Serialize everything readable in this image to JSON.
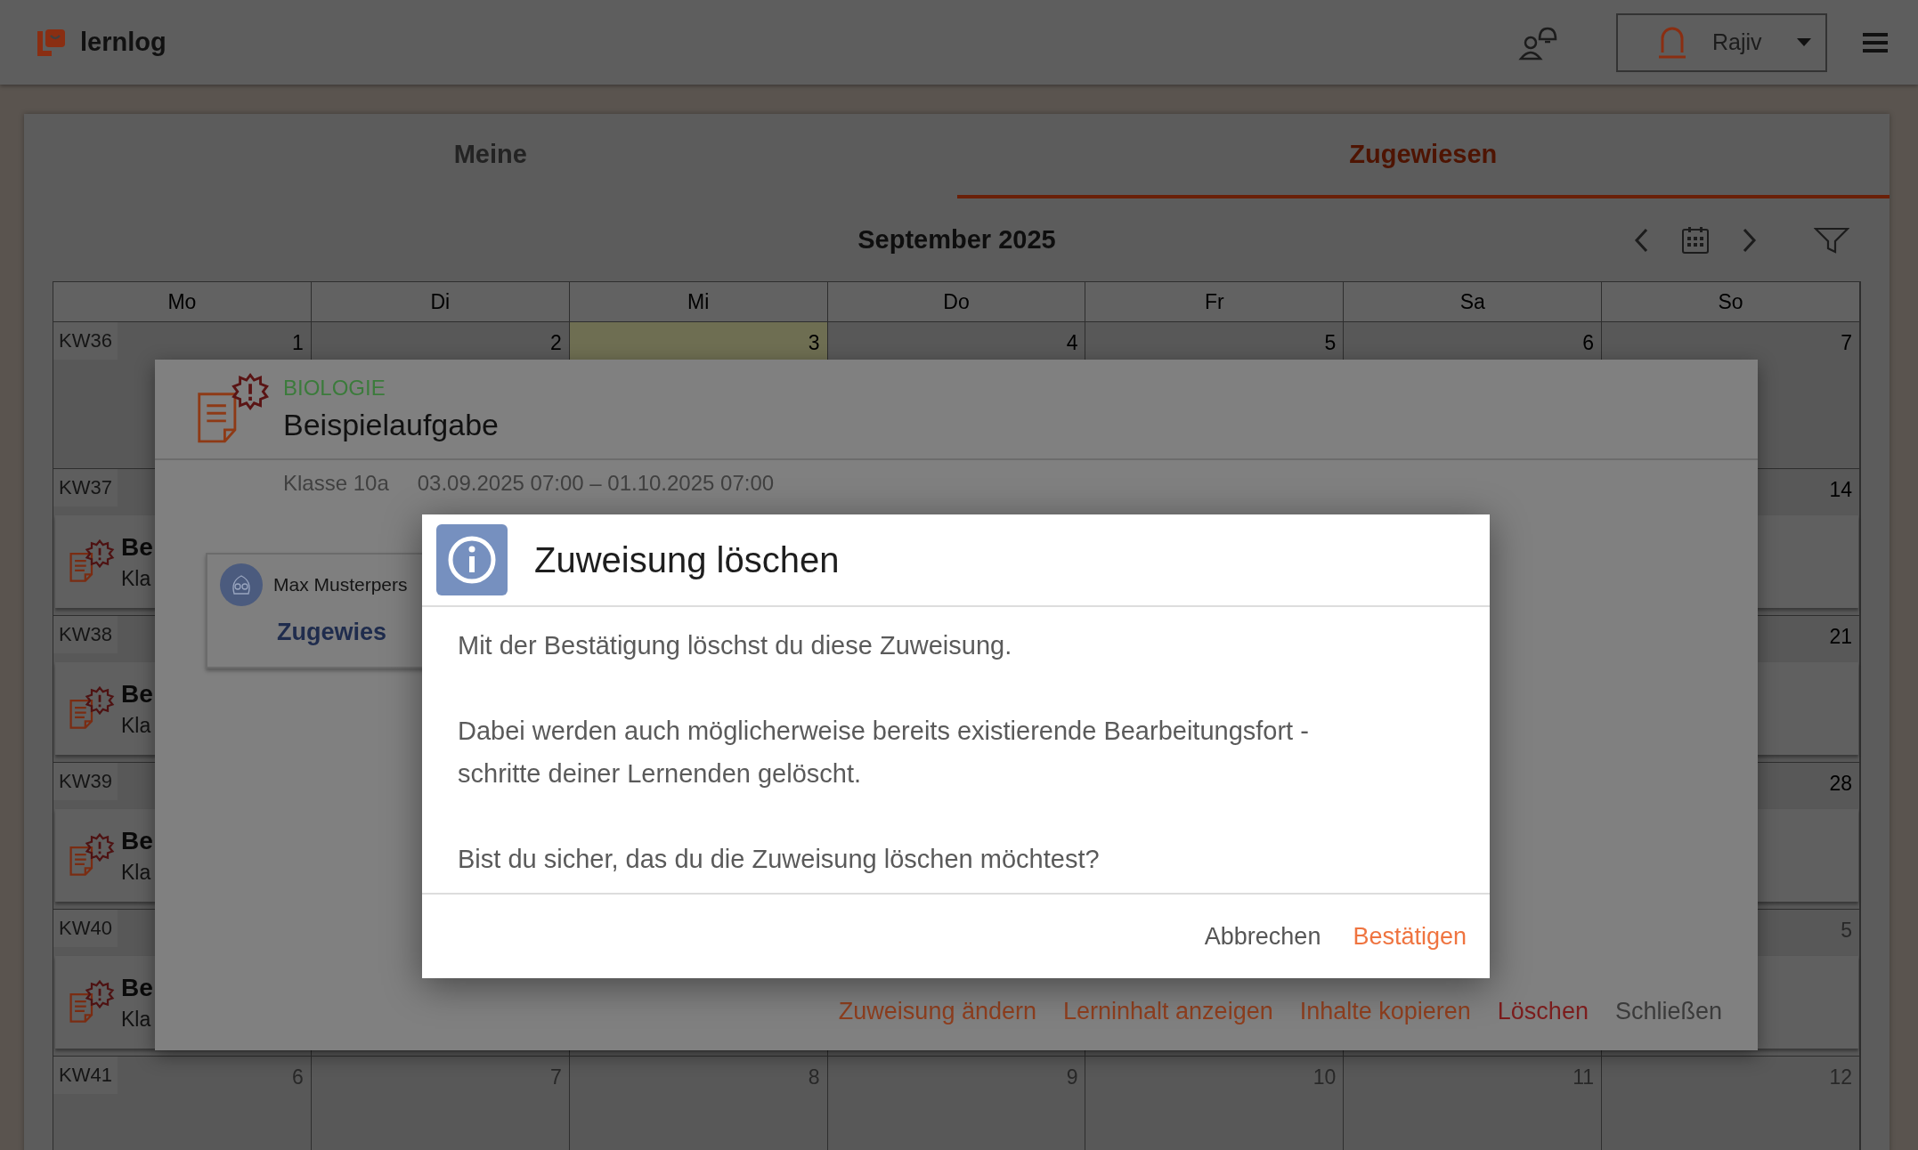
{
  "header": {
    "app_name": "lernlog",
    "user_name": "Rajiv"
  },
  "tabs": [
    {
      "label": "Meine",
      "selected": false
    },
    {
      "label": "Zugewiesen",
      "selected": true
    }
  ],
  "calendar": {
    "title": "September 2025",
    "weekdays": [
      "Mo",
      "Di",
      "Mi",
      "Do",
      "Fr",
      "Sa",
      "So"
    ],
    "weeks": [
      {
        "label": "KW36",
        "days": [
          {
            "number": "1",
            "today": false,
            "outside": false
          },
          {
            "number": "2",
            "today": false,
            "outside": false
          },
          {
            "number": "3",
            "today": true,
            "outside": false
          },
          {
            "number": "4",
            "today": false,
            "outside": false
          },
          {
            "number": "5",
            "today": false,
            "outside": false
          },
          {
            "number": "6",
            "today": false,
            "outside": false
          },
          {
            "number": "7",
            "today": false,
            "outside": false
          }
        ]
      },
      {
        "label": "KW37",
        "days": [
          {
            "number": "14",
            "outside": false
          }
        ],
        "event": {
          "title": "Be",
          "detail": "Kla"
        }
      },
      {
        "label": "KW38",
        "days": [
          {
            "number": "21",
            "outside": false
          }
        ],
        "event": {
          "title": "Be",
          "detail": "Kla"
        }
      },
      {
        "label": "KW39",
        "days": [
          {
            "number": "28",
            "outside": false
          }
        ],
        "event": {
          "title": "Be",
          "detail": "Kla"
        }
      },
      {
        "label": "KW40",
        "days": [
          {
            "number": "5",
            "outside": true
          }
        ],
        "event": {
          "title": "Be",
          "detail": "Kla"
        }
      },
      {
        "label": "KW41",
        "days": [
          {
            "number": "6",
            "outside": true
          },
          {
            "number": "7",
            "outside": true
          },
          {
            "number": "8",
            "outside": true
          },
          {
            "number": "9",
            "outside": true
          },
          {
            "number": "10",
            "outside": true
          },
          {
            "number": "11",
            "outside": true
          },
          {
            "number": "12",
            "outside": true
          }
        ]
      }
    ]
  },
  "detail": {
    "subject": "BIOLOGIE",
    "title": "Beispielaufgabe",
    "class": "Klasse 10a",
    "period": "03.09.2025 07:00 – 01.10.2025 07:00",
    "student": {
      "name": "Max Musterpers",
      "status": "Zugewies"
    },
    "actions": [
      {
        "label": "Zuweisung ändern",
        "kind": "primary"
      },
      {
        "label": "Lerninhalt anzeigen",
        "kind": "primary"
      },
      {
        "label": "Inhalte kopieren",
        "kind": "primary"
      },
      {
        "label": "Löschen",
        "kind": "danger"
      },
      {
        "label": "Schließen",
        "kind": "neutral"
      }
    ]
  },
  "confirm": {
    "title": "Zuweisung löschen",
    "paragraphs": [
      "Mit der Bestätigung löschst du diese Zuweisung.",
      "Dabei werden auch möglicherweise bereits existierende Bearbeitungsfort -\nschritte deiner Lernenden gelöscht.",
      "Bist du sicher, das du die Zuweisung löschen möchtest?"
    ],
    "buttons": [
      {
        "label": "Abbrechen",
        "kind": "neutral"
      },
      {
        "label": "Bestätigen",
        "kind": "primary"
      }
    ]
  }
}
